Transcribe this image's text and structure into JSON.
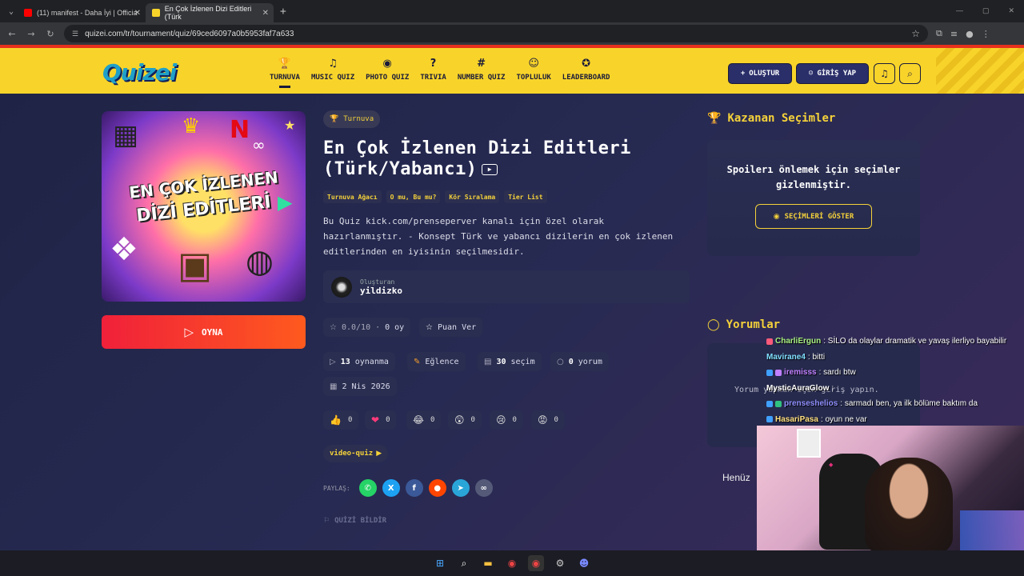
{
  "browser": {
    "tabs": [
      {
        "label": "(11) manifest - Daha İyi | Officia",
        "fav_color": "#ff0000"
      },
      {
        "label": "En Çok İzlenen Dizi Editleri (Türk",
        "fav_color": "#f8d42a"
      }
    ],
    "url": "quizei.com/tr/tournament/quiz/69ced6097a0b5953faf7a633"
  },
  "header": {
    "logo": "Quizei",
    "nav": [
      {
        "icon": "trophy-icon",
        "glyph": "🏆",
        "label": "TURNUVA",
        "active": true
      },
      {
        "icon": "music-icon",
        "glyph": "♫",
        "label": "MUSIC QUIZ"
      },
      {
        "icon": "camera-icon",
        "glyph": "◉",
        "label": "PHOTO QUIZ"
      },
      {
        "icon": "question-icon",
        "glyph": "?",
        "label": "TRIVIA"
      },
      {
        "icon": "hash-icon",
        "glyph": "#",
        "label": "NUMBER QUIZ"
      },
      {
        "icon": "users-icon",
        "glyph": "☺",
        "label": "TOPLULUK"
      },
      {
        "icon": "award-icon",
        "glyph": "✪",
        "label": "LEADERBOARD"
      }
    ],
    "create_label": "OLUŞTUR",
    "login_label": "GİRİŞ YAP"
  },
  "quiz": {
    "cover_line1": "EN ÇOK İZLENEN",
    "cover_line2": "DİZİ EDİTLERİ",
    "play_label": "OYNA",
    "badge": "Turnuva",
    "title": "En Çok İzlenen Dizi Editleri (Türk/Yabancı)",
    "tags": [
      "Turnuva Ağacı",
      "O mu, Bu mu?",
      "Kör Sıralama",
      "Tier List"
    ],
    "description": "Bu Quiz kick.com/prenseperver kanalı için özel olarak hazırlanmıştır. - Konsept Türk ve yabancı dizilerin en çok izlenen editlerinden en iyisinin seçilmesidir.",
    "creator_label": "Oluşturan",
    "creator_name": "yildizko",
    "rating": "0.0/10",
    "votes": "0 oy",
    "rate_label": "Puan Ver",
    "plays_count": "13",
    "plays_label": "oynanma",
    "category": "Eğlence",
    "choices_count": "30",
    "choices_label": "seçim",
    "comments_count": "0",
    "comments_label": "yorum",
    "date": "2 Nis 2026",
    "reactions": [
      {
        "emoji": "👍",
        "count": "0"
      },
      {
        "emoji": "❤",
        "count": "0"
      },
      {
        "emoji": "😂",
        "count": "0"
      },
      {
        "emoji": "😲",
        "count": "0"
      },
      {
        "emoji": "😢",
        "count": "0"
      },
      {
        "emoji": "😡",
        "count": "0"
      }
    ],
    "video_tag": "video-quiz",
    "share_label": "PAYLAŞ:",
    "share": [
      {
        "name": "whatsapp-icon",
        "glyph": "✆",
        "color": "#25d366"
      },
      {
        "name": "x-icon",
        "glyph": "X",
        "color": "#1da1f2"
      },
      {
        "name": "facebook-icon",
        "glyph": "f",
        "color": "#3b5998"
      },
      {
        "name": "reddit-icon",
        "glyph": "●",
        "color": "#ff4500"
      },
      {
        "name": "telegram-icon",
        "glyph": "➤",
        "color": "#2aa5d8"
      },
      {
        "name": "link-icon",
        "glyph": "∞",
        "color": "#555a78"
      }
    ],
    "report_label": "QUİZİ BİLDİR"
  },
  "sidebar": {
    "winners_title": "Kazanan Seçimler",
    "winners_message": "Spoilerı önlemek için seçimler gizlenmiştir.",
    "show_choices_label": "SEÇİMLERİ GÖSTER",
    "comments_title": "Yorumlar",
    "comments_message": "Yorum yapmak için giriş yapın.",
    "henuz": "Henüz"
  },
  "chat": [
    {
      "user": "CharliErgun",
      "color": "#a8f080",
      "msg": ": SİLO da olaylar dramatik ve yavaş ilerliyo bayabilir"
    },
    {
      "user": "Mavirane4",
      "color": "#80e0ff",
      "msg": ": bitti"
    },
    {
      "user": "iremisss",
      "color": "#c080ff",
      "msg": ": sardı btw"
    },
    {
      "user": "MysticAuraGlow",
      "color": "#ffffff",
      "msg": ":"
    },
    {
      "user": "prenseshelios",
      "color": "#9090ff",
      "msg": ": sarmadı ben, ya ilk bölüme baktım da"
    },
    {
      "user": "HasariPasa",
      "color": "#ffe080",
      "msg": ": oyun ne var"
    }
  ]
}
